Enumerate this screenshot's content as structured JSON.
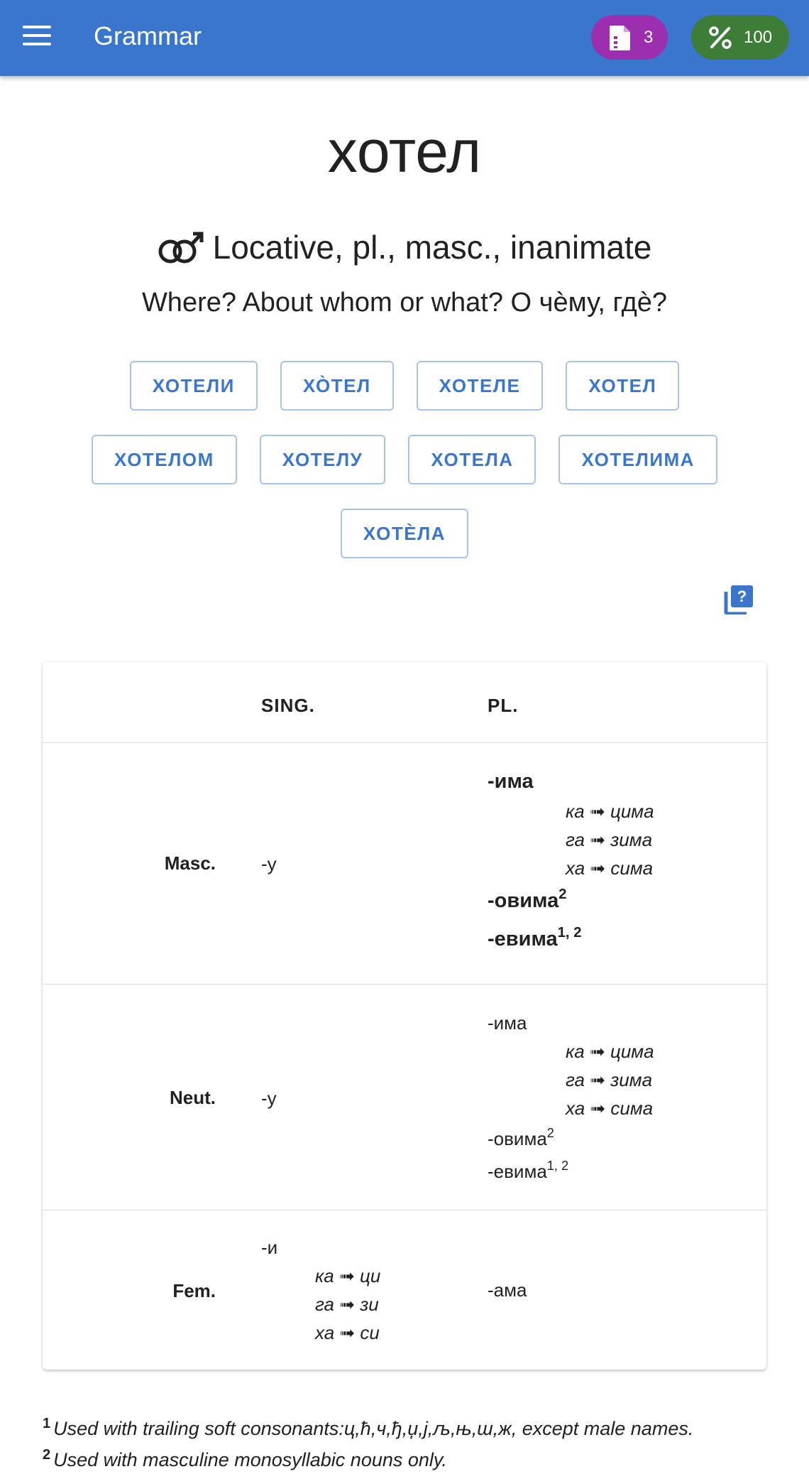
{
  "appbar": {
    "title": "Grammar",
    "files_count": "3",
    "percent": "100",
    "files_icon": "file-icon",
    "percent_icon": "percent-icon",
    "menu_icon": "menu-icon"
  },
  "header": {
    "word": "хотел",
    "gender_icon": "masculine-neuter-icon",
    "case_description": "Locative, pl., masc., inanimate",
    "question": "Where? About whom or what?  О чѐму, гдѐ?"
  },
  "forms": {
    "row1": [
      "ХОТЕЛИ",
      "ХО̀ТЕЛ",
      "ХОТЕЛЕ",
      "ХОТЕЛ"
    ],
    "row2": [
      "ХОТЕЛОМ",
      "ХОТЕЛУ",
      "ХОТЕЛА",
      "ХОТЕЛИМА"
    ],
    "row3": [
      "ХОТЀЛА"
    ]
  },
  "help_icon": "help-book-icon",
  "table": {
    "headers": [
      "SING.",
      "PL."
    ],
    "rows": [
      {
        "gender": "Masc.",
        "sing": "-у",
        "pl_main": "-има",
        "pl_subs": [
          "ка ➟ цима",
          "га ➟ зима",
          "ха ➟ сима"
        ],
        "pl_ov": "-овима",
        "pl_ov_sup": "2",
        "pl_ev": "-евима",
        "pl_ev_sup": "1, 2"
      },
      {
        "gender": "Neut.",
        "sing": "-у",
        "pl_main": "-има",
        "pl_subs": [
          "ка ➟ цима",
          "га ➟ зима",
          "ха ➟ сима"
        ],
        "pl_ov": "-овима",
        "pl_ov_sup": "2",
        "pl_ev": "-евима",
        "pl_ev_sup": "1, 2"
      },
      {
        "gender": "Fem.",
        "sing": "-и",
        "sing_subs": [
          "ка ➟ ци",
          "га ➟ зи",
          "ха ➟ си"
        ],
        "pl": "-ама"
      }
    ]
  },
  "footnotes": [
    {
      "num": "1",
      "text": "Used with trailing soft consonants:ц,ћ,ч,ђ,џ,ј,љ,њ,ш,ж, except male names."
    },
    {
      "num": "2",
      "text": "Used with masculine monosyllabic nouns only."
    }
  ]
}
